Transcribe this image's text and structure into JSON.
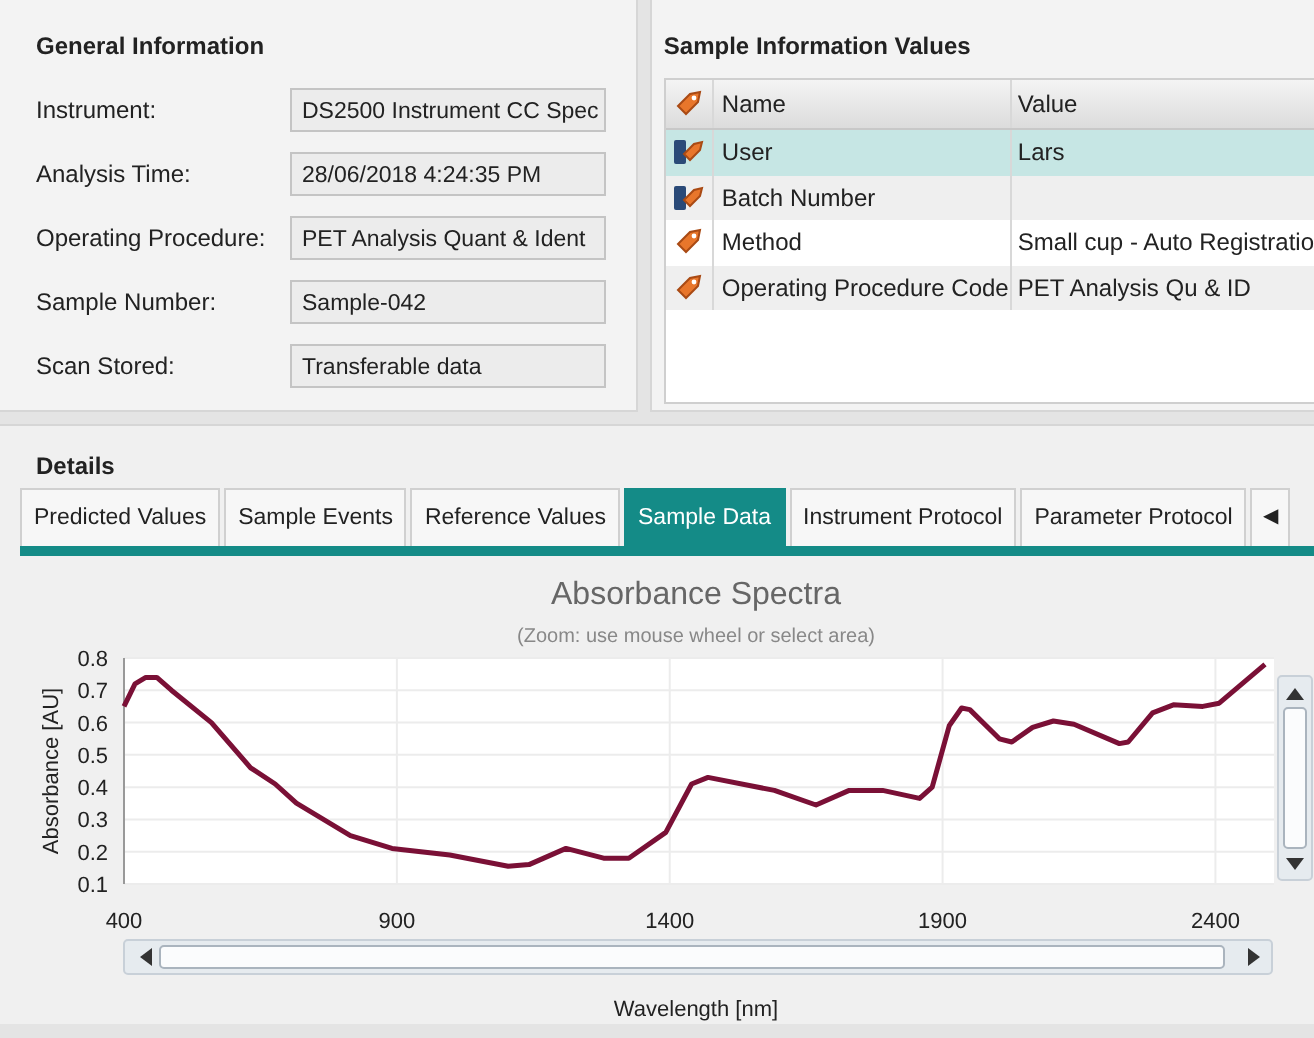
{
  "general_information": {
    "title": "General Information",
    "fields": [
      {
        "label": "Instrument:",
        "value": "DS2500 Instrument CC Spec"
      },
      {
        "label": "Analysis Time:",
        "value": "28/06/2018 4:24:35 PM"
      },
      {
        "label": "Operating Procedure:",
        "value": "PET Analysis Quant & Ident"
      },
      {
        "label": "Sample Number:",
        "value": "Sample-042"
      },
      {
        "label": "Scan Stored:",
        "value": "Transferable data"
      }
    ]
  },
  "sample_information": {
    "title": "Sample Information Values",
    "columns": [
      "Name",
      "Value"
    ],
    "rows": [
      {
        "kind": "user",
        "name": "User",
        "value": "Lars",
        "selected": true
      },
      {
        "kind": "user",
        "name": "Batch Number",
        "value": "",
        "selected": false
      },
      {
        "kind": "tag",
        "name": "Method",
        "value": "Small cup - Auto Registratio",
        "selected": false
      },
      {
        "kind": "tag",
        "name": "Operating Procedure Code",
        "value": "PET Analysis Qu & ID",
        "selected": false
      }
    ]
  },
  "details": {
    "title": "Details",
    "tabs": [
      {
        "label": "Predicted Values",
        "selected": false
      },
      {
        "label": "Sample Events",
        "selected": false
      },
      {
        "label": "Reference Values",
        "selected": false
      },
      {
        "label": "Sample Data",
        "selected": true
      },
      {
        "label": "Instrument Protocol",
        "selected": false
      },
      {
        "label": "Parameter Protocol",
        "selected": false
      }
    ],
    "tab_scroll": "◀",
    "chart_hint": "(Zoom: use mouse wheel or select area)",
    "chart_data": {
      "type": "line",
      "grid": true,
      "title": "Absorbance Spectra",
      "xlabel": "Wavelength [nm]",
      "ylabel": "Absorbance [AU]",
      "xlim": [
        400,
        2500
      ],
      "ylim": [
        0.1,
        0.8
      ],
      "xticks": [
        400,
        900,
        1400,
        1900,
        2400
      ],
      "yticks": [
        0.1,
        0.2,
        0.3,
        0.4,
        0.5,
        0.6,
        0.7,
        0.8
      ],
      "x": [
        400,
        420,
        440,
        460,
        487,
        560,
        632,
        677,
        716,
        815,
        891,
        997,
        1104,
        1142,
        1210,
        1279,
        1325,
        1393,
        1440,
        1470,
        1592,
        1668,
        1729,
        1790,
        1858,
        1881,
        1912,
        1935,
        1950,
        2004,
        2027,
        2065,
        2103,
        2141,
        2224,
        2240,
        2285,
        2323,
        2377,
        2407,
        2491
      ],
      "series": [
        {
          "color": "#7a1036",
          "values": [
            0.65,
            0.72,
            0.74,
            0.74,
            0.7,
            0.6,
            0.46,
            0.41,
            0.35,
            0.25,
            0.21,
            0.19,
            0.155,
            0.16,
            0.21,
            0.18,
            0.18,
            0.26,
            0.41,
            0.43,
            0.39,
            0.345,
            0.39,
            0.39,
            0.365,
            0.4,
            0.59,
            0.645,
            0.64,
            0.55,
            0.54,
            0.585,
            0.605,
            0.595,
            0.535,
            0.54,
            0.63,
            0.655,
            0.65,
            0.66,
            0.78
          ]
        }
      ]
    }
  }
}
